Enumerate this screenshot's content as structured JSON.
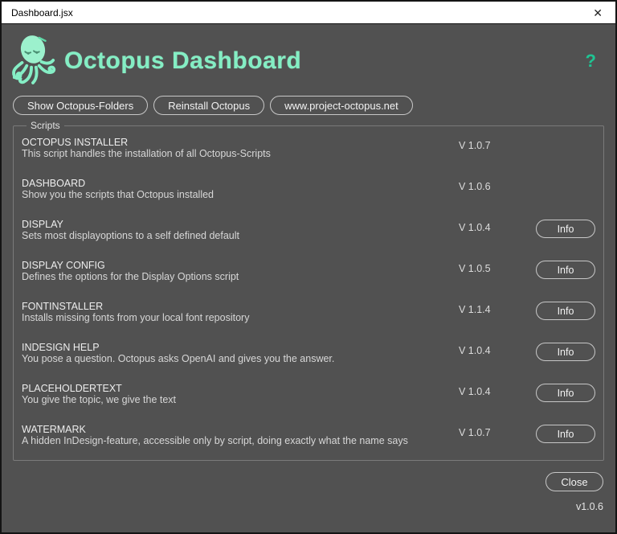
{
  "window": {
    "title": "Dashboard.jsx",
    "close_glyph": "✕"
  },
  "header": {
    "title": "Octopus Dashboard",
    "help_label": "?"
  },
  "toolbar": {
    "buttons": [
      {
        "label": "Show Octopus-Folders"
      },
      {
        "label": "Reinstall Octopus"
      },
      {
        "label": "www.project-octopus.net"
      }
    ]
  },
  "scripts": {
    "group_label": "Scripts",
    "info_label": "Info",
    "items": [
      {
        "name": "OCTOPUS INSTALLER",
        "description": "This script handles the installation of all Octopus-Scripts",
        "version": "V 1.0.7",
        "has_info": false
      },
      {
        "name": "DASHBOARD",
        "description": "Show you the scripts that Octopus installed",
        "version": "V 1.0.6",
        "has_info": false
      },
      {
        "name": "DISPLAY",
        "description": "Sets most displayoptions to a self defined default",
        "version": "V 1.0.4",
        "has_info": true
      },
      {
        "name": "DISPLAY CONFIG",
        "description": "Defines the options for the Display Options script",
        "version": "V 1.0.5",
        "has_info": true
      },
      {
        "name": "FONTINSTALLER",
        "description": "Installs missing fonts from your local font repository",
        "version": "V 1.1.4",
        "has_info": true
      },
      {
        "name": "INDESIGN HELP",
        "description": "You pose a question. Octopus asks OpenAI and gives you the answer.",
        "version": "V 1.0.4",
        "has_info": true
      },
      {
        "name": "PLACEHOLDERTEXT",
        "description": "You give the topic, we give the text",
        "version": "V 1.0.4",
        "has_info": true
      },
      {
        "name": "WATERMARK",
        "description": "A hidden InDesign-feature, accessible only by script, doing exactly what the name says",
        "version": "V 1.0.7",
        "has_info": true
      }
    ]
  },
  "footer": {
    "close_label": "Close",
    "app_version": "v1.0.6"
  },
  "colors": {
    "accent_mint": "#84eec4",
    "accent_teal": "#1fc493",
    "window_bg": "#515151",
    "titlebar_bg": "#ffffff"
  }
}
